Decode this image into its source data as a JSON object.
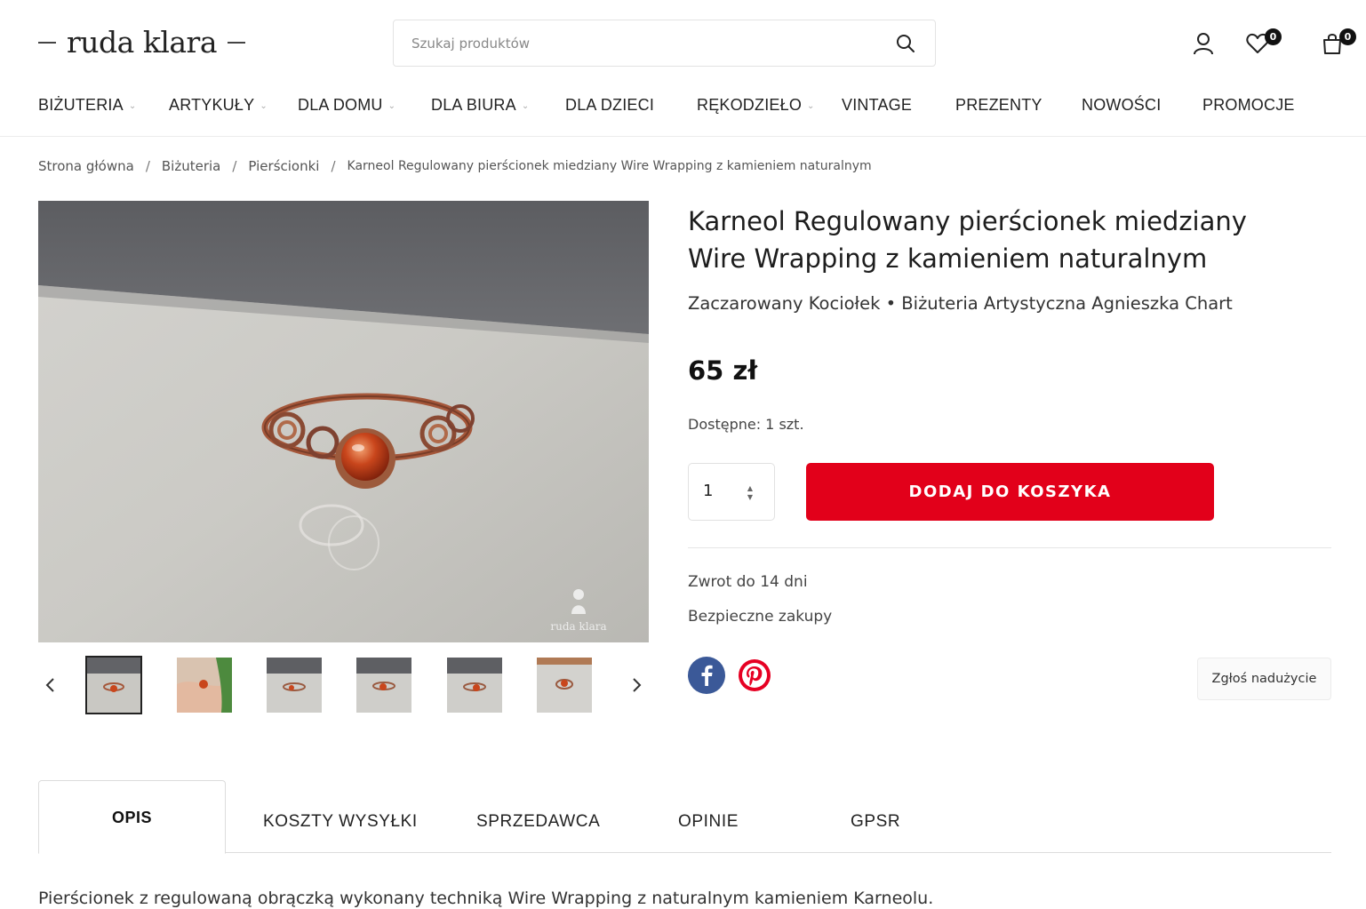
{
  "header": {
    "logo_text": "ruda klara",
    "search_placeholder": "Szukaj produktów",
    "wishlist_count": "0",
    "cart_count": "0"
  },
  "nav": {
    "items": [
      {
        "label": "BIŻUTERIA",
        "has_dropdown": true
      },
      {
        "label": "ARTYKUŁY",
        "has_dropdown": true
      },
      {
        "label": "DLA DOMU",
        "has_dropdown": true
      },
      {
        "label": "DLA BIURA",
        "has_dropdown": true
      },
      {
        "label": "DLA DZIECI",
        "has_dropdown": false
      },
      {
        "label": "RĘKODZIEŁO",
        "has_dropdown": true
      },
      {
        "label": "VINTAGE",
        "has_dropdown": false
      },
      {
        "label": "PREZENTY",
        "has_dropdown": false
      },
      {
        "label": "NOWOŚCI",
        "has_dropdown": false
      },
      {
        "label": "PROMOCJE",
        "has_dropdown": false
      }
    ]
  },
  "breadcrumb": {
    "home": "Strona główna",
    "level1": "Biżuteria",
    "level2": "Pierścionki",
    "current": "Karneol Regulowany pierścionek miedziany Wire Wrapping z kamieniem naturalnym"
  },
  "product": {
    "title": "Karneol Regulowany pierścionek miedziany Wire Wrapping z kamieniem naturalnym",
    "seller": "Zaczarowany Kociołek • Biżuteria Artystyczna Agnieszka Chart",
    "price": "65 zł",
    "stock": "Dostępne: 1 szt.",
    "quantity": "1",
    "add_to_cart_label": "DODAJ DO KOSZYKA",
    "returns": "Zwrot do 14 dni",
    "secure": "Bezpieczne zakupy",
    "report_label": "Zgłoś nadużycie",
    "image_watermark": "ruda klara",
    "thumbnail_count": 6,
    "active_thumbnail": 1
  },
  "tabs": {
    "items": [
      "OPIS",
      "KOSZTY WYSYŁKI",
      "SPRZEDAWCA",
      "OPINIE",
      "GPSR"
    ],
    "active": "OPIS"
  },
  "description": {
    "text": "Pierścionek z regulowaną obrączką wykonany techniką Wire Wrapping z naturalnym kamieniem Karneolu."
  },
  "colors": {
    "accent_red": "#e2001a",
    "facebook_blue": "#3b5998",
    "pinterest_red": "#e60023"
  }
}
